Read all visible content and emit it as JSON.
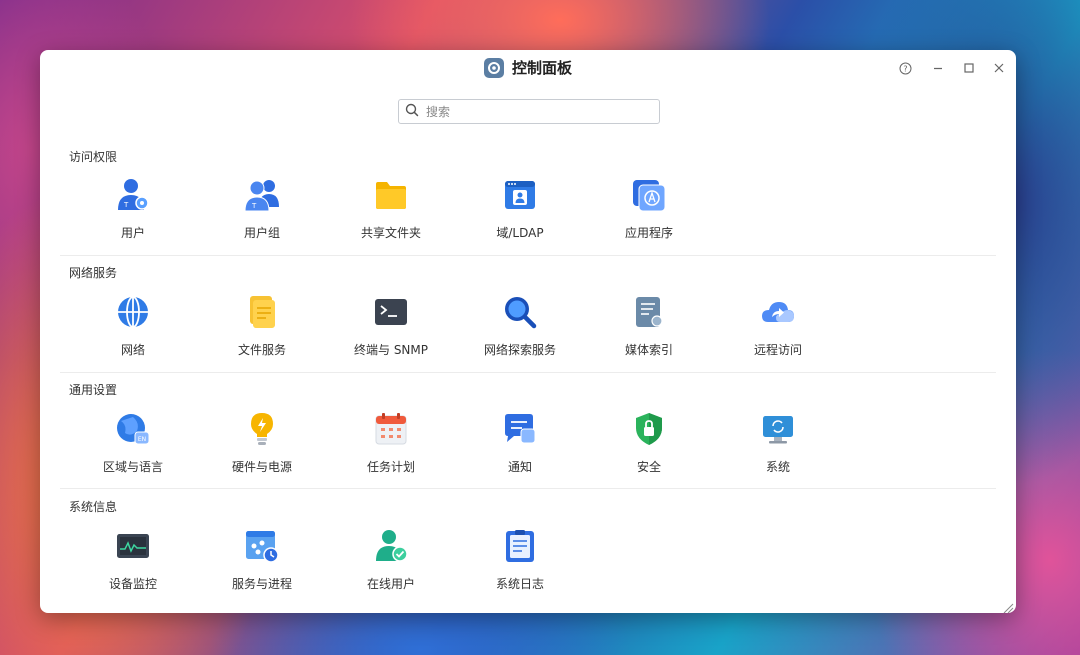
{
  "window": {
    "title": "控制面板"
  },
  "search": {
    "placeholder": "搜索"
  },
  "sections": [
    {
      "title": "访问权限",
      "items": [
        {
          "label": "用户",
          "icon": "user-icon"
        },
        {
          "label": "用户组",
          "icon": "user-group-icon"
        },
        {
          "label": "共享文件夹",
          "icon": "folder-icon"
        },
        {
          "label": "域/LDAP",
          "icon": "domain-icon"
        },
        {
          "label": "应用程序",
          "icon": "app-store-icon"
        }
      ]
    },
    {
      "title": "网络服务",
      "items": [
        {
          "label": "网络",
          "icon": "globe-icon"
        },
        {
          "label": "文件服务",
          "icon": "file-service-icon"
        },
        {
          "label": "终端与 SNMP",
          "icon": "terminal-icon"
        },
        {
          "label": "网络探索服务",
          "icon": "magnifier-icon"
        },
        {
          "label": "媒体索引",
          "icon": "media-index-icon"
        },
        {
          "label": "远程访问",
          "icon": "cloud-share-icon"
        }
      ]
    },
    {
      "title": "通用设置",
      "items": [
        {
          "label": "区域与语言",
          "icon": "region-icon"
        },
        {
          "label": "硬件与电源",
          "icon": "lightbulb-icon"
        },
        {
          "label": "任务计划",
          "icon": "calendar-icon"
        },
        {
          "label": "通知",
          "icon": "notification-icon"
        },
        {
          "label": "安全",
          "icon": "shield-icon"
        },
        {
          "label": "系统",
          "icon": "monitor-icon"
        }
      ]
    },
    {
      "title": "系统信息",
      "items": [
        {
          "label": "设备监控",
          "icon": "device-monitor-icon"
        },
        {
          "label": "服务与进程",
          "icon": "process-icon"
        },
        {
          "label": "在线用户",
          "icon": "online-user-icon"
        },
        {
          "label": "系统日志",
          "icon": "system-log-icon"
        }
      ]
    }
  ],
  "colors": {
    "accent": "#3478f6",
    "title_icon": "#5b7ea3"
  }
}
